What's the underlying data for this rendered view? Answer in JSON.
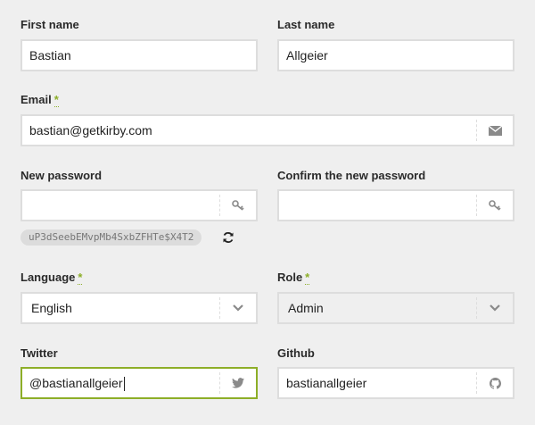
{
  "form": {
    "first_name": {
      "label": "First name",
      "value": "Bastian"
    },
    "last_name": {
      "label": "Last name",
      "value": "Allgeier"
    },
    "email": {
      "label": "Email",
      "required_mark": "*",
      "value": "bastian@getkirby.com",
      "icon": "envelope-icon"
    },
    "new_password": {
      "label": "New password",
      "value": "",
      "icon": "key-icon"
    },
    "confirm_password": {
      "label": "Confirm the new password",
      "value": "",
      "icon": "key-icon"
    },
    "password_suggestion": {
      "value": "uP3dSeebEMvpMb4SxbZFHTe$X4T2",
      "icon": "refresh-icon"
    },
    "language": {
      "label": "Language",
      "required_mark": "*",
      "value": "English",
      "icon": "chevron-down-icon"
    },
    "role": {
      "label": "Role",
      "required_mark": "*",
      "value": "Admin",
      "icon": "chevron-down-icon"
    },
    "twitter": {
      "label": "Twitter",
      "value": "@bastianallgeier",
      "icon": "twitter-icon"
    },
    "github": {
      "label": "Github",
      "value": "bastianallgeier",
      "icon": "github-icon"
    }
  },
  "colors": {
    "accent": "#8dae28",
    "border": "#dddddd",
    "background": "#efefef"
  }
}
